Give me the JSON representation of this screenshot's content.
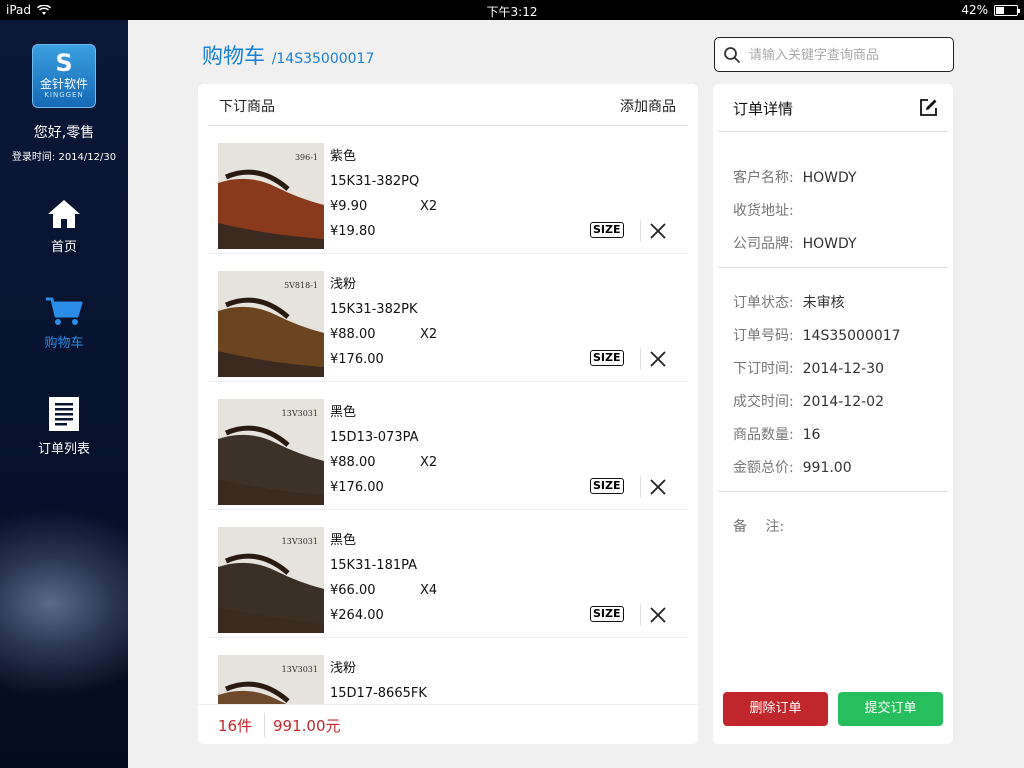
{
  "status_bar": {
    "device": "iPad",
    "time": "下午3:12",
    "battery": "42%",
    "battery_level": 0.42
  },
  "sidebar": {
    "logo": {
      "mark": "S",
      "name": "金针软件",
      "english": "KINGGEN"
    },
    "greeting": "您好,零售",
    "login_time": "登录时间: 2014/12/30",
    "nav": [
      {
        "label": "首页",
        "icon": "home-icon"
      },
      {
        "label": "购物车",
        "icon": "cart-icon",
        "active": true
      },
      {
        "label": "订单列表",
        "icon": "list-icon"
      }
    ]
  },
  "header": {
    "title": "购物车",
    "order_code": "/14S35000017"
  },
  "search": {
    "placeholder": "请输入关键字查询商品",
    "value": ""
  },
  "cart": {
    "header_left": "下订商品",
    "header_right": "添加商品",
    "items": [
      {
        "color": "紫色",
        "sku": "15K31-382PQ",
        "price": "¥9.90",
        "qty": "X2",
        "total": "¥19.80",
        "tag": "396-1",
        "swatch": "#8a3a1c"
      },
      {
        "color": "浅粉",
        "sku": "15K31-382PK",
        "price": "¥88.00",
        "qty": "X2",
        "total": "¥176.00",
        "tag": "5V818-1",
        "swatch": "#6b4420"
      },
      {
        "color": "黑色",
        "sku": "15D13-073PA",
        "price": "¥88.00",
        "qty": "X2",
        "total": "¥176.00",
        "tag": "13V3031",
        "swatch": "#3c3228"
      },
      {
        "color": "黑色",
        "sku": "15K31-181PA",
        "price": "¥66.00",
        "qty": "X4",
        "total": "¥264.00",
        "tag": "13V3031",
        "swatch": "#3a3026"
      },
      {
        "color": "浅粉",
        "sku": "15D17-8665FK",
        "price": "",
        "qty": "",
        "total": "",
        "tag": "13V3031",
        "swatch": "#6d4a2c"
      }
    ],
    "size_label": "SIZE",
    "footer": {
      "count": "16件",
      "amount": "991.00元"
    }
  },
  "detail": {
    "title": "订单详情",
    "customer": {
      "label": "客户名称:",
      "value": "HOWDY"
    },
    "address": {
      "label": "收货地址:",
      "value": ""
    },
    "brand": {
      "label": "公司品牌:",
      "value": "HOWDY"
    },
    "status": {
      "label": "订单状态:",
      "value": "未审核"
    },
    "order_no": {
      "label": "订单号码:",
      "value": "14S35000017"
    },
    "order_time": {
      "label": "下订时间:",
      "value": "2014-12-30"
    },
    "deal_time": {
      "label": "成交时间:",
      "value": "2014-12-02"
    },
    "quantity": {
      "label": "商品数量:",
      "value": "16"
    },
    "total": {
      "label": "金额总价:",
      "value": "991.00"
    },
    "remark": {
      "label": "备　 注:",
      "value": ""
    },
    "delete_label": "删除订单",
    "submit_label": "提交订单"
  }
}
